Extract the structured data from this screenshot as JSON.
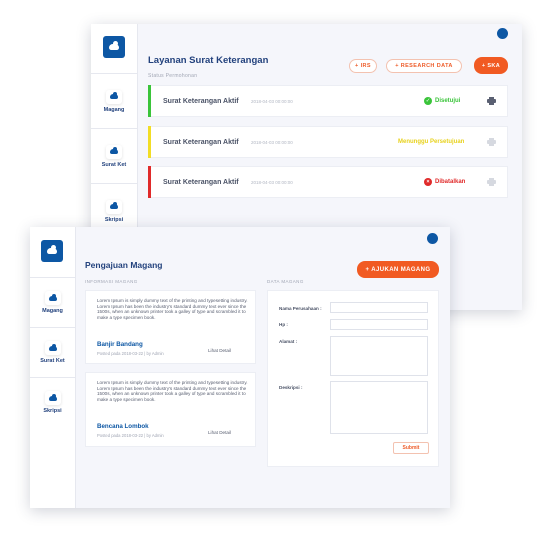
{
  "nav": {
    "items": [
      {
        "label": "Magang",
        "icon": "cloud-icon"
      },
      {
        "label": "Surat Ket",
        "icon": "cloud-icon"
      },
      {
        "label": "Skripsi",
        "icon": "cloud-icon"
      }
    ]
  },
  "surat": {
    "title": "Layanan Surat Keterangan",
    "subtitle": "Status Permohonan",
    "buttons": {
      "irs": "+ IRS",
      "research": "+ RESEARCH DATA",
      "ska": "+ SKA"
    },
    "rows": [
      {
        "title": "Surat Keterangan Aktif",
        "date": "2018-04-03 00:00:00",
        "status": "Disetujui",
        "status_color": "#3ac43a",
        "bar_color": "#3ac43a",
        "printer_active": true
      },
      {
        "title": "Surat Keterangan Aktif",
        "date": "2018-04-03 00:00:00",
        "status": "Menunggu Persetujuan",
        "status_color": "#e8d21e",
        "bar_color": "#f2dd25",
        "printer_active": false
      },
      {
        "title": "Surat Keterangan Aktif",
        "date": "2018-04-03 00:00:00",
        "status": "Dibatalkan",
        "status_color": "#e02a2a",
        "bar_color": "#e02a2a",
        "printer_active": false
      }
    ]
  },
  "magang": {
    "title": "Pengajuan Magang",
    "add_button": "+ AJUKAN MAGANG",
    "info_label": "INFORMASI MAGANG",
    "data_label": "DATA MAGANG",
    "cards": [
      {
        "desc": "Lorem Ipsum is simply dummy text of the printing and typesetting industry. Lorem Ipsum has been the industry's standard dummy text ever since the 1500s, when an unknown printer took a galley of type and scrambled it to make a type specimen book.",
        "title": "Banjir Bandang",
        "meta": "Posted pada 2018-03-22 | by Admin",
        "link": "Lihat Detail"
      },
      {
        "desc": "Lorem Ipsum is simply dummy text of the printing and typesetting industry. Lorem Ipsum has been the industry's standard dummy text ever since the 1500s, when an unknown printer took a galley of type and scrambled it to make a type specimen book.",
        "title": "Bencana Lombok",
        "meta": "Posted pada 2018-03-22 | by Admin",
        "link": "Lihat Detail"
      }
    ],
    "form": {
      "perusahaan_label": "Nama Perusahaan :",
      "hp_label": "Hp :",
      "alamat_label": "Alamat :",
      "deskripsi_label": "Deskripsi :",
      "submit_label": "Submit"
    }
  },
  "colors": {
    "brand": "#0d57a4",
    "accent": "#f15a22",
    "heading": "#23427d"
  }
}
